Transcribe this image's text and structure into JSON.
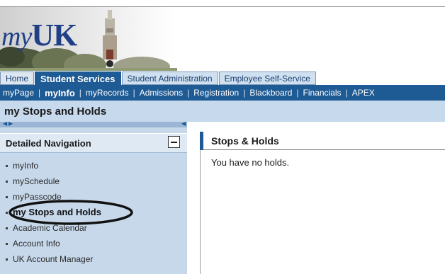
{
  "app": {
    "logo_my": "my",
    "logo_uk": "UK"
  },
  "tabs": [
    {
      "label": "Home",
      "active": false
    },
    {
      "label": "Student Services",
      "active": true
    },
    {
      "label": "Student Administration",
      "active": false
    },
    {
      "label": "Employee Self-Service",
      "active": false
    }
  ],
  "subnav": [
    {
      "label": "myPage",
      "active": false
    },
    {
      "label": "myInfo",
      "active": true
    },
    {
      "label": "myRecords",
      "active": false
    },
    {
      "label": "Admissions",
      "active": false
    },
    {
      "label": "Registration",
      "active": false
    },
    {
      "label": "Blackboard",
      "active": false
    },
    {
      "label": "Financials",
      "active": false
    },
    {
      "label": "APEX",
      "active": false
    }
  ],
  "page": {
    "title": "my Stops and Holds"
  },
  "sidebar": {
    "header": "Detailed Navigation",
    "items": [
      {
        "label": "myInfo",
        "bold": false
      },
      {
        "label": "mySchedule",
        "bold": false
      },
      {
        "label": "myPasscode",
        "bold": false
      },
      {
        "label": "my Stops and Holds",
        "bold": true
      },
      {
        "label": "Academic Calendar",
        "bold": false
      },
      {
        "label": "Account Info",
        "bold": false
      },
      {
        "label": "UK Account Manager",
        "bold": false
      }
    ]
  },
  "content": {
    "title": "Stops & Holds",
    "message": "You have no holds."
  },
  "colors": {
    "brand_blue": "#1e5a93",
    "panel_blue": "#c6d8ea",
    "logo_blue": "#1f3f86"
  }
}
